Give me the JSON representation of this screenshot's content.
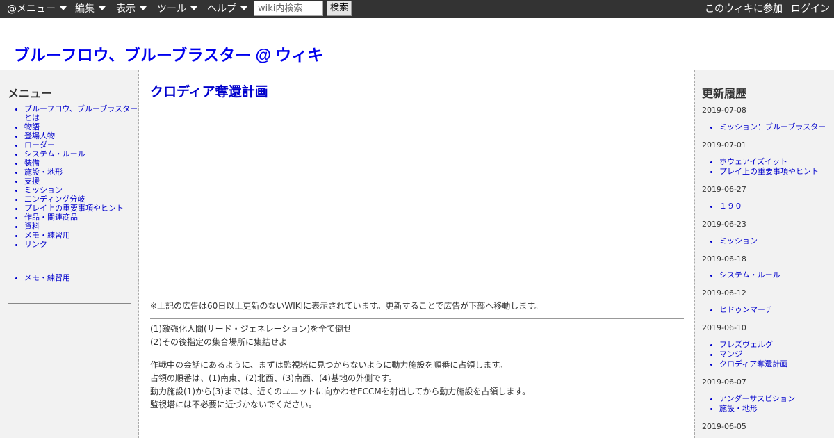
{
  "topbar": {
    "menus": [
      "@メニュー",
      "編集",
      "表示",
      "ツール",
      "ヘルプ"
    ],
    "search_placeholder": "wiki内検索",
    "search_button": "検索",
    "join": "このウィキに参加",
    "login": "ログイン"
  },
  "site_title": "ブルーフロウ、ブルーブラスター @ ウィキ",
  "left_menu": {
    "heading": "メニュー",
    "items": [
      "ブルーフロウ、ブルーブラスターとは",
      "物語",
      "登場人物",
      "ローダー",
      "システム・ルール",
      "装備",
      "施設・地形",
      "支援",
      "ミッション",
      "エンディング分岐",
      "プレイ上の重要事項やヒント",
      "作品・関連商品",
      "資料",
      "メモ・練習用",
      "リンク"
    ],
    "extra_items": [
      "メモ・練習用"
    ]
  },
  "main": {
    "title": "クロディア奪還計画",
    "ad_notice": "※上記の広告は60日以上更新のないWIKIに表示されています。更新することで広告が下部へ移動します。",
    "objectives": [
      "(1)敵強化人間(サード・ジェネレーション)を全て倒せ",
      "(2)その後指定の集合場所に集結せよ"
    ],
    "body": [
      "作戦中の会話にあるように、まずは監視塔に見つからないように動力施設を順番に占領します。",
      "占領の順番は、(1)南東、(2)北西、(3)南西、(4)基地の外側です。",
      "動力施設(1)から(3)までは、近くのユニットに向かわせECCMを射出してから動力施設を占領します。",
      "監視塔には不必要に近づかないでください。"
    ]
  },
  "history": {
    "heading": "更新履歴",
    "groups": [
      {
        "date": "2019-07-08",
        "items": [
          "ミッション：ブルーブラスター"
        ]
      },
      {
        "date": "2019-07-01",
        "items": [
          "ホウェアイズイット",
          "プレイ上の重要事項やヒント"
        ]
      },
      {
        "date": "2019-06-27",
        "items": [
          "１９０"
        ]
      },
      {
        "date": "2019-06-23",
        "items": [
          "ミッション"
        ]
      },
      {
        "date": "2019-06-18",
        "items": [
          "システム・ルール"
        ]
      },
      {
        "date": "2019-06-12",
        "items": [
          "ヒドゥンマーチ"
        ]
      },
      {
        "date": "2019-06-10",
        "items": [
          "フレズヴェルグ",
          "マンジ",
          "クロディア奪還計画"
        ]
      },
      {
        "date": "2019-06-07",
        "items": [
          "アンダーサスピション",
          "施設・地形"
        ]
      },
      {
        "date": "2019-06-05",
        "items": []
      }
    ]
  }
}
